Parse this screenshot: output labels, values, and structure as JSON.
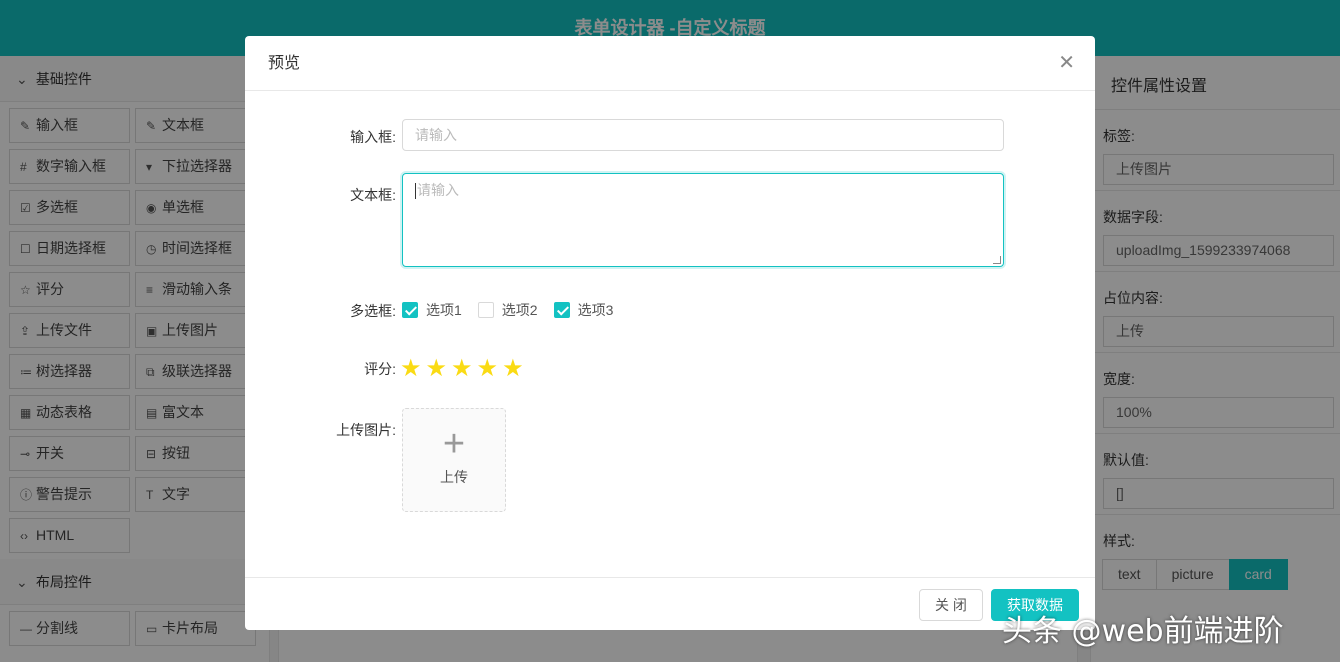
{
  "app": {
    "title": "表单设计器 -自定义标题"
  },
  "left": {
    "basic_title": "基础控件",
    "basic_controls": [
      {
        "icon": "✎",
        "label": "输入框"
      },
      {
        "icon": "✎",
        "label": "文本框"
      },
      {
        "icon": "#",
        "label": "数字输入框"
      },
      {
        "icon": "▾",
        "label": "下拉选择器"
      },
      {
        "icon": "☑",
        "label": "多选框"
      },
      {
        "icon": "◉",
        "label": "单选框"
      },
      {
        "icon": "☐",
        "label": "日期选择框"
      },
      {
        "icon": "◷",
        "label": "时间选择框"
      },
      {
        "icon": "☆",
        "label": "评分"
      },
      {
        "icon": "≡",
        "label": "滑动输入条"
      },
      {
        "icon": "⇪",
        "label": "上传文件"
      },
      {
        "icon": "▣",
        "label": "上传图片"
      },
      {
        "icon": "≔",
        "label": "树选择器"
      },
      {
        "icon": "⧉",
        "label": "级联选择器"
      },
      {
        "icon": "▦",
        "label": "动态表格"
      },
      {
        "icon": "▤",
        "label": "富文本"
      },
      {
        "icon": "⊸",
        "label": "开关"
      },
      {
        "icon": "⊟",
        "label": "按钮"
      },
      {
        "icon": "ⓘ",
        "label": "警告提示"
      },
      {
        "icon": "T",
        "label": "文字"
      },
      {
        "icon": "‹›",
        "label": "HTML"
      }
    ],
    "layout_title": "布局控件",
    "layout_controls": [
      {
        "icon": "—",
        "label": "分割线"
      },
      {
        "icon": "▭",
        "label": "卡片布局"
      }
    ]
  },
  "right": {
    "title": "控件属性设置",
    "props": [
      {
        "label": "标签:",
        "value": "上传图片"
      },
      {
        "label": "数据字段:",
        "value": "uploadImg_1599233974068"
      },
      {
        "label": "占位内容:",
        "value": "上传"
      },
      {
        "label": "宽度:",
        "value": "100%"
      },
      {
        "label": "默认值:",
        "value": "[]"
      }
    ],
    "style_label": "样式:",
    "style_options": [
      "text",
      "picture",
      "card"
    ],
    "style_selected": "card",
    "next_value": "3"
  },
  "modal": {
    "title": "预览",
    "close_icon": "close-icon",
    "fields": {
      "input_label": "输入框:",
      "input_placeholder": "请输入",
      "textarea_label": "文本框:",
      "textarea_placeholder": "请输入",
      "checkbox_label": "多选框:",
      "checkbox_options": [
        {
          "label": "选项1",
          "checked": true
        },
        {
          "label": "选项2",
          "checked": false
        },
        {
          "label": "选项3",
          "checked": true
        }
      ],
      "rate_label": "评分:",
      "rate_value": 5,
      "rate_max": 5,
      "upload_label": "上传图片:",
      "upload_text": "上传"
    },
    "buttons": {
      "close": "关 闭",
      "get_data": "获取数据"
    }
  },
  "watermark": "头条 @web前端进阶",
  "colors": {
    "accent": "#13c2c2",
    "star": "#fadb14"
  }
}
